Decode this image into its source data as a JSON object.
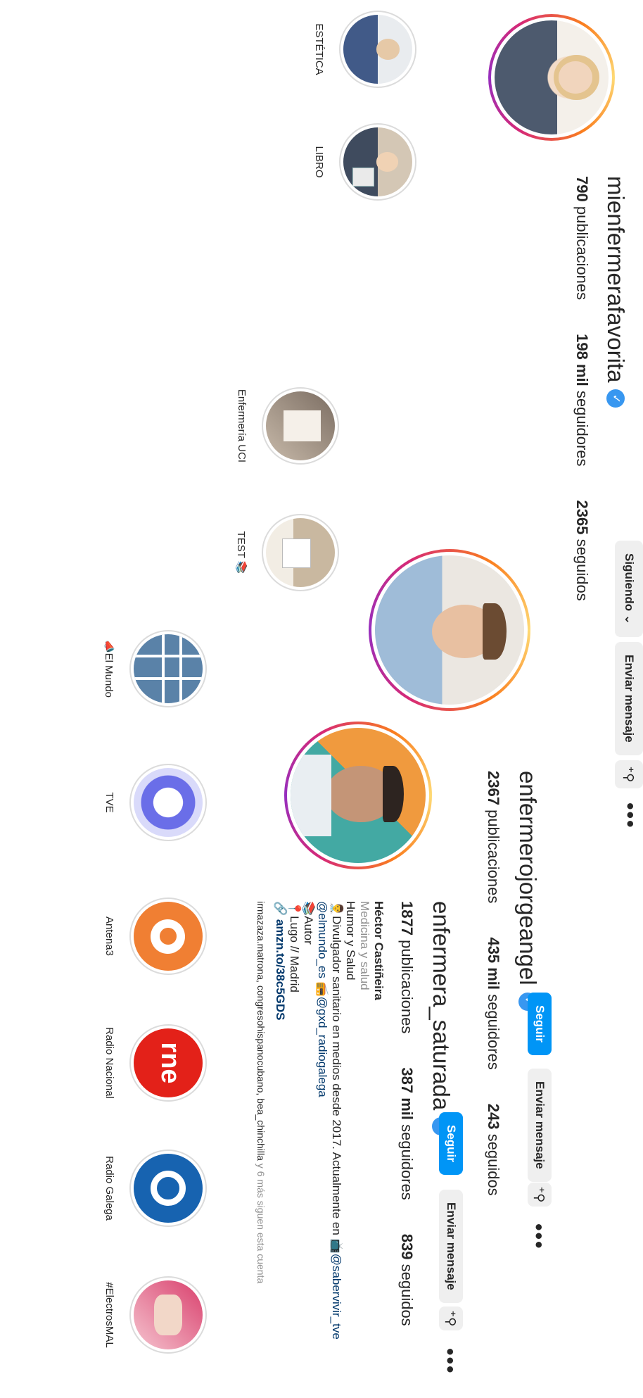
{
  "profile1": {
    "username": "mienfermerafavorita",
    "following_button": "Siguiendo",
    "message_button": "Enviar mensaje",
    "stats": {
      "posts": "790",
      "posts_label": "publicaciones",
      "followers": "198 mil",
      "followers_label": "seguidores",
      "following": "2365",
      "following_label": "seguidos"
    },
    "highlights": [
      {
        "label": "ESTÉTICA"
      },
      {
        "label": "LIBRO"
      },
      {
        "label": "Enfermería UCI"
      },
      {
        "label": "TEST 📚"
      }
    ]
  },
  "profile2": {
    "username": "enfermerojorgeangel",
    "follow_button": "Seguir",
    "message_button": "Enviar mensaje",
    "stats": {
      "posts": "2367",
      "posts_label": "publicaciones",
      "followers": "435 mil",
      "followers_label": "seguidores",
      "following": "243",
      "following_label": "seguidos"
    }
  },
  "profile3": {
    "username": "enfermera_saturada",
    "follow_button": "Seguir",
    "message_button": "Enviar mensaje",
    "stats": {
      "posts": "1877",
      "posts_label": "publicaciones",
      "followers": "387 mil",
      "followers_label": "seguidores",
      "following": "839",
      "following_label": "seguidos"
    },
    "bio": {
      "name": "Héctor Castiñeira",
      "category": "Medicina y salud",
      "line1": "Humor y Salud",
      "line2_prefix": "👨‍⚕️Divulgador sanitario en medios desde 2017. Actualmente en 📺",
      "line2_link": "@sabervivir_tve",
      "line3_link1": "@elmundo_es",
      "line3_link2": "@gxd_radiogalega",
      "line4": "📚Autor",
      "line5": "📍Lugo // Madrid",
      "url": "amzn.to/38c5GDS"
    },
    "followed_by": "irmazaza.matrona, congresohispanocubano, bea_chinchilla",
    "followed_by_suffix": "y 6 más siguen esta cuenta",
    "highlights": [
      {
        "label": "📣El Mundo"
      },
      {
        "label": "TVE"
      },
      {
        "label": "Antena3"
      },
      {
        "label": "Radio Nacional"
      },
      {
        "label": "Radio Galega"
      },
      {
        "label": "#ElectrosMAL"
      }
    ]
  },
  "icons": {
    "more": "more-icon",
    "add_person": "add-person-icon",
    "chevron": "chevron-down-icon",
    "verified": "verified-badge-icon"
  },
  "colors": {
    "accent": "#0095f6",
    "verified": "#3897f0"
  }
}
